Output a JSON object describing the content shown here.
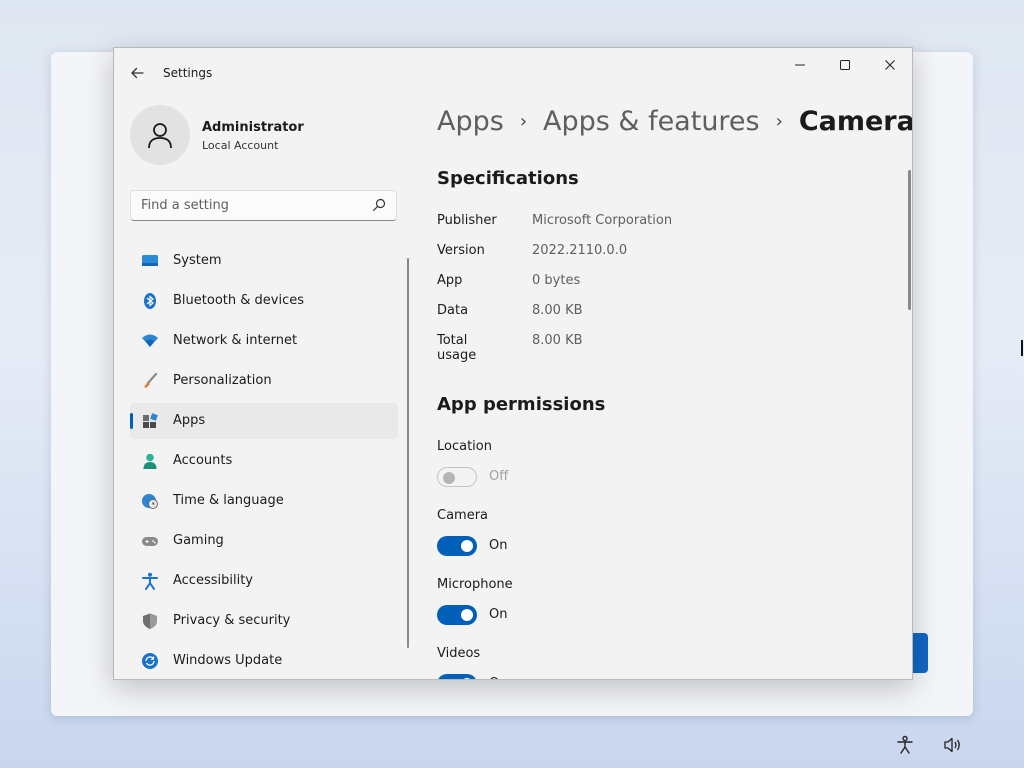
{
  "window": {
    "title": "Settings"
  },
  "profile": {
    "name": "Administrator",
    "account_type": "Local Account"
  },
  "search": {
    "placeholder": "Find a setting"
  },
  "nav": {
    "items": [
      {
        "label": "System",
        "icon": "monitor-icon"
      },
      {
        "label": "Bluetooth & devices",
        "icon": "bluetooth-icon"
      },
      {
        "label": "Network & internet",
        "icon": "wifi-icon"
      },
      {
        "label": "Personalization",
        "icon": "brush-icon"
      },
      {
        "label": "Apps",
        "icon": "apps-icon",
        "active": true
      },
      {
        "label": "Accounts",
        "icon": "person-icon"
      },
      {
        "label": "Time & language",
        "icon": "globe-clock-icon"
      },
      {
        "label": "Gaming",
        "icon": "gamepad-icon"
      },
      {
        "label": "Accessibility",
        "icon": "accessibility-icon"
      },
      {
        "label": "Privacy & security",
        "icon": "shield-icon"
      },
      {
        "label": "Windows Update",
        "icon": "update-icon"
      }
    ]
  },
  "breadcrumb": [
    "Apps",
    "Apps & features",
    "Camera"
  ],
  "specifications": {
    "title": "Specifications",
    "rows": [
      {
        "label": "Publisher",
        "value": "Microsoft Corporation"
      },
      {
        "label": "Version",
        "value": "2022.2110.0.0"
      },
      {
        "label": "App",
        "value": "0 bytes"
      },
      {
        "label": "Data",
        "value": "8.00 KB"
      },
      {
        "label": "Total usage",
        "value": "8.00 KB"
      }
    ]
  },
  "permissions": {
    "title": "App permissions",
    "items": [
      {
        "label": "Location",
        "state": "Off",
        "enabled": false,
        "disabled": true
      },
      {
        "label": "Camera",
        "state": "On",
        "enabled": true
      },
      {
        "label": "Microphone",
        "state": "On",
        "enabled": true
      },
      {
        "label": "Videos",
        "state": "On",
        "enabled": true
      }
    ]
  },
  "colors": {
    "accent": "#005fb8",
    "window_bg": "#f3f3f3"
  }
}
